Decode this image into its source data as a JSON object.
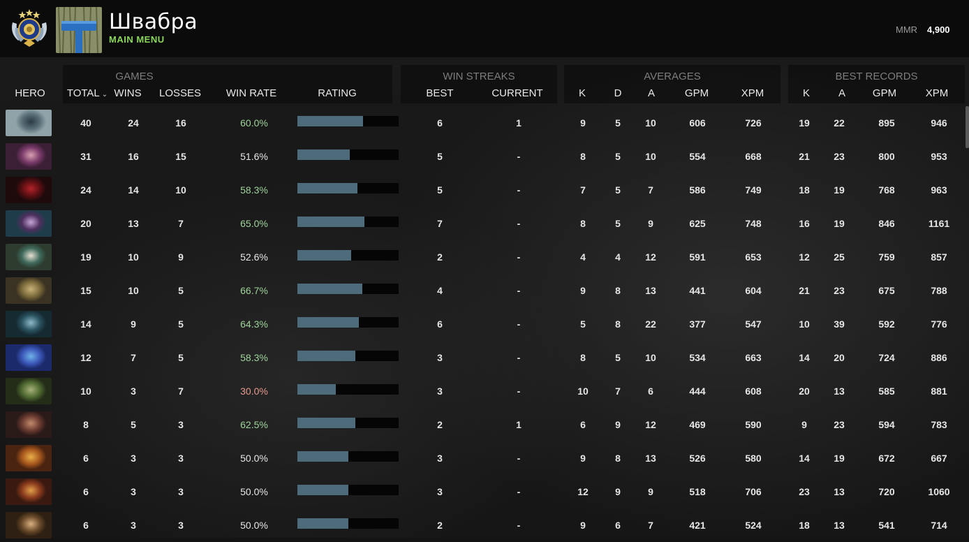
{
  "header": {
    "player_name": "Швабра",
    "menu_link": "MAIN MENU",
    "mmr_label": "MMR",
    "mmr_value": "4,900",
    "rank_badge_icon": "rank-medal-icon",
    "avatar_icon": "mop-avatar-icon"
  },
  "groups": {
    "games": "GAMES",
    "win_streaks": "WIN STREAKS",
    "averages": "AVERAGES",
    "best_records": "BEST RECORDS"
  },
  "columns": {
    "hero": "HERO",
    "total": "TOTAL",
    "wins": "WINS",
    "losses": "LOSSES",
    "win_rate": "WIN RATE",
    "rating": "RATING",
    "best": "BEST",
    "current": "CURRENT",
    "avg_k": "K",
    "avg_d": "D",
    "avg_a": "A",
    "avg_gpm": "GPM",
    "avg_xpm": "XPM",
    "rec_k": "K",
    "rec_a": "A",
    "rec_gpm": "GPM",
    "rec_xpm": "XPM"
  },
  "colors": {
    "win_rate_good": "#9fd49b",
    "win_rate_bad": "#e89a8e",
    "win_rate_neutral": "#e6e6e6",
    "rating_fill": "#4e6b7c",
    "menu_green": "#8bd65c"
  },
  "rows": [
    {
      "hero_icon": "hero-portrait-1",
      "portrait_colors": [
        "#5a6f78",
        "#2b3a44",
        "#8fa3a8"
      ],
      "total": "40",
      "wins": "24",
      "losses": "16",
      "win_rate": "60.0%",
      "rating": 0.65,
      "best": "6",
      "current": "1",
      "avg_k": "9",
      "avg_d": "5",
      "avg_a": "10",
      "avg_gpm": "606",
      "avg_xpm": "726",
      "rec_k": "19",
      "rec_a": "22",
      "rec_gpm": "895",
      "rec_xpm": "946"
    },
    {
      "hero_icon": "hero-portrait-2",
      "portrait_colors": [
        "#7a3a6a",
        "#d8a0b0",
        "#3b1f35"
      ],
      "total": "31",
      "wins": "16",
      "losses": "15",
      "win_rate": "51.6%",
      "rating": 0.52,
      "best": "5",
      "current": "-",
      "avg_k": "8",
      "avg_d": "5",
      "avg_a": "10",
      "avg_gpm": "554",
      "avg_xpm": "668",
      "rec_k": "21",
      "rec_a": "23",
      "rec_gpm": "800",
      "rec_xpm": "953"
    },
    {
      "hero_icon": "hero-portrait-3",
      "portrait_colors": [
        "#5a0f12",
        "#b3222a",
        "#1e0a0b"
      ],
      "total": "24",
      "wins": "14",
      "losses": "10",
      "win_rate": "58.3%",
      "rating": 0.59,
      "best": "5",
      "current": "-",
      "avg_k": "7",
      "avg_d": "5",
      "avg_a": "7",
      "avg_gpm": "586",
      "avg_xpm": "749",
      "rec_k": "18",
      "rec_a": "19",
      "rec_gpm": "768",
      "rec_xpm": "963"
    },
    {
      "hero_icon": "hero-portrait-4",
      "portrait_colors": [
        "#4d2f5e",
        "#c7a4d8",
        "#1f3c4a"
      ],
      "total": "20",
      "wins": "13",
      "losses": "7",
      "win_rate": "65.0%",
      "rating": 0.66,
      "best": "7",
      "current": "-",
      "avg_k": "8",
      "avg_d": "5",
      "avg_a": "9",
      "avg_gpm": "625",
      "avg_xpm": "748",
      "rec_k": "16",
      "rec_a": "19",
      "rec_gpm": "846",
      "rec_xpm": "1161"
    },
    {
      "hero_icon": "hero-portrait-5",
      "portrait_colors": [
        "#3f6a5c",
        "#e6e0d2",
        "#2d3c2f"
      ],
      "total": "19",
      "wins": "10",
      "losses": "9",
      "win_rate": "52.6%",
      "rating": 0.53,
      "best": "2",
      "current": "-",
      "avg_k": "4",
      "avg_d": "4",
      "avg_a": "12",
      "avg_gpm": "591",
      "avg_xpm": "653",
      "rec_k": "12",
      "rec_a": "25",
      "rec_gpm": "759",
      "rec_xpm": "857"
    },
    {
      "hero_icon": "hero-portrait-6",
      "portrait_colors": [
        "#7b6a3a",
        "#c9b27a",
        "#3a3222"
      ],
      "total": "15",
      "wins": "10",
      "losses": "5",
      "win_rate": "66.7%",
      "rating": 0.64,
      "best": "4",
      "current": "-",
      "avg_k": "9",
      "avg_d": "8",
      "avg_a": "13",
      "avg_gpm": "441",
      "avg_xpm": "604",
      "rec_k": "21",
      "rec_a": "23",
      "rec_gpm": "675",
      "rec_xpm": "788"
    },
    {
      "hero_icon": "hero-portrait-7",
      "portrait_colors": [
        "#2a5360",
        "#8fb9c8",
        "#162a32"
      ],
      "total": "14",
      "wins": "9",
      "losses": "5",
      "win_rate": "64.3%",
      "rating": 0.61,
      "best": "6",
      "current": "-",
      "avg_k": "5",
      "avg_d": "8",
      "avg_a": "22",
      "avg_gpm": "377",
      "avg_xpm": "547",
      "rec_k": "10",
      "rec_a": "39",
      "rec_gpm": "592",
      "rec_xpm": "776"
    },
    {
      "hero_icon": "hero-portrait-8",
      "portrait_colors": [
        "#3b57b8",
        "#6fb2e8",
        "#1b2a6a"
      ],
      "total": "12",
      "wins": "7",
      "losses": "5",
      "win_rate": "58.3%",
      "rating": 0.57,
      "best": "3",
      "current": "-",
      "avg_k": "8",
      "avg_d": "5",
      "avg_a": "10",
      "avg_gpm": "534",
      "avg_xpm": "663",
      "rec_k": "14",
      "rec_a": "20",
      "rec_gpm": "724",
      "rec_xpm": "886"
    },
    {
      "hero_icon": "hero-portrait-9",
      "portrait_colors": [
        "#4f6a32",
        "#a8b07a",
        "#242d18"
      ],
      "total": "10",
      "wins": "3",
      "losses": "7",
      "win_rate": "30.0%",
      "rating": 0.38,
      "best": "3",
      "current": "-",
      "avg_k": "10",
      "avg_d": "7",
      "avg_a": "6",
      "avg_gpm": "444",
      "avg_xpm": "608",
      "rec_k": "20",
      "rec_a": "13",
      "rec_gpm": "585",
      "rec_xpm": "881"
    },
    {
      "hero_icon": "hero-portrait-10",
      "portrait_colors": [
        "#6a3a30",
        "#c08a6a",
        "#2a1a18"
      ],
      "total": "8",
      "wins": "5",
      "losses": "3",
      "win_rate": "62.5%",
      "rating": 0.57,
      "best": "2",
      "current": "1",
      "avg_k": "6",
      "avg_d": "9",
      "avg_a": "12",
      "avg_gpm": "469",
      "avg_xpm": "590",
      "rec_k": "9",
      "rec_a": "23",
      "rec_gpm": "594",
      "rec_xpm": "783"
    },
    {
      "hero_icon": "hero-portrait-11",
      "portrait_colors": [
        "#a6561c",
        "#e9b04a",
        "#4a2410"
      ],
      "total": "6",
      "wins": "3",
      "losses": "3",
      "win_rate": "50.0%",
      "rating": 0.5,
      "best": "3",
      "current": "-",
      "avg_k": "9",
      "avg_d": "8",
      "avg_a": "13",
      "avg_gpm": "526",
      "avg_xpm": "580",
      "rec_k": "14",
      "rec_a": "19",
      "rec_gpm": "672",
      "rec_xpm": "667"
    },
    {
      "hero_icon": "hero-portrait-12",
      "portrait_colors": [
        "#8a3a1c",
        "#e0a04a",
        "#3a1a10"
      ],
      "total": "6",
      "wins": "3",
      "losses": "3",
      "win_rate": "50.0%",
      "rating": 0.5,
      "best": "3",
      "current": "-",
      "avg_k": "12",
      "avg_d": "9",
      "avg_a": "9",
      "avg_gpm": "518",
      "avg_xpm": "706",
      "rec_k": "23",
      "rec_a": "13",
      "rec_gpm": "720",
      "rec_xpm": "1060"
    },
    {
      "hero_icon": "hero-portrait-13",
      "portrait_colors": [
        "#6a4a2a",
        "#d8b080",
        "#2e2012"
      ],
      "total": "6",
      "wins": "3",
      "losses": "3",
      "win_rate": "50.0%",
      "rating": 0.5,
      "best": "2",
      "current": "-",
      "avg_k": "9",
      "avg_d": "6",
      "avg_a": "7",
      "avg_gpm": "421",
      "avg_xpm": "524",
      "rec_k": "18",
      "rec_a": "13",
      "rec_gpm": "541",
      "rec_xpm": "714"
    }
  ]
}
